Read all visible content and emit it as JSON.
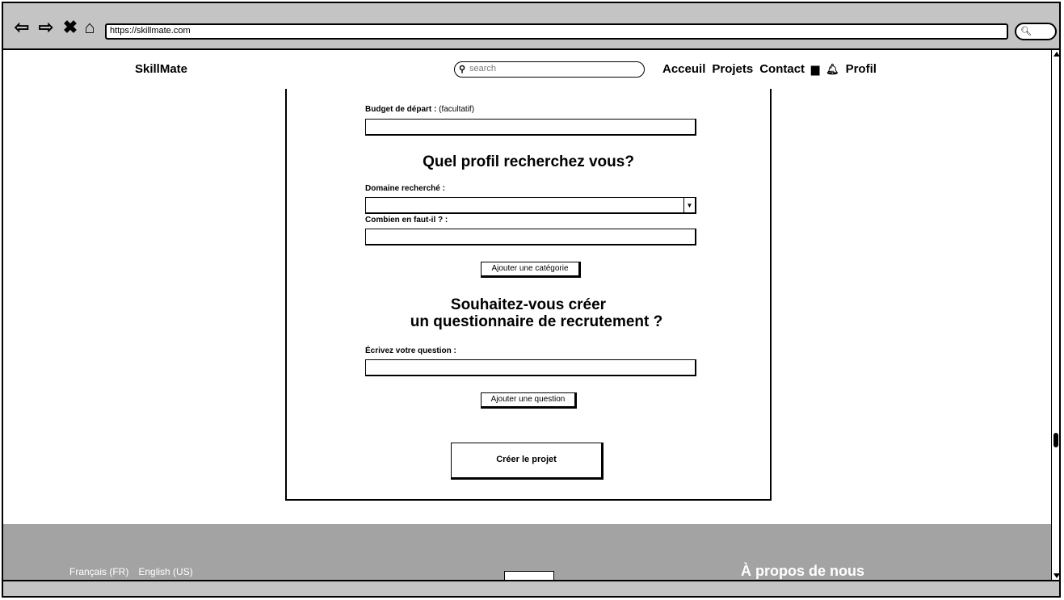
{
  "browser": {
    "url": "https://skillmate.com"
  },
  "header": {
    "logo": "SkillMate",
    "search_placeholder": "search",
    "nav": {
      "home": "Acceuil",
      "projects": "Projets",
      "contact": "Contact",
      "profile": "Profil"
    }
  },
  "form": {
    "budget_label": "Budget de départ :",
    "budget_optional": "(facultatif)",
    "profile_heading": "Quel profil recherchez vous?",
    "domain_label": "Domaine recherché :",
    "count_label": "Combien en faut-il ? :",
    "add_category_button": "Ajouter une catégorie",
    "questionnaire_heading_line1": "Souhaitez-vous créer",
    "questionnaire_heading_line2": "un questionnaire de recrutement ?",
    "question_label": "Écrivez votre question :",
    "add_question_button": "Ajouter une question",
    "create_button": "Créer le projet"
  },
  "footer": {
    "lang_fr": "Français (FR)",
    "lang_en": "English (US)",
    "about": "À propos de nous"
  }
}
